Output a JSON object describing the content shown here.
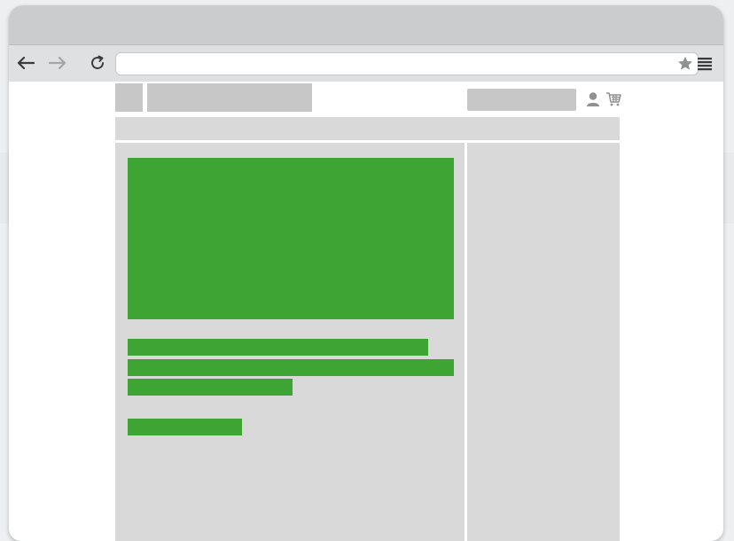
{
  "browser": {
    "address_url": "",
    "icons": {
      "back": "arrow-left-icon",
      "forward": "arrow-right-icon",
      "reload": "reload-icon",
      "bookmark": "star-icon",
      "menu": "hamburger-menu-icon",
      "account": "user-icon",
      "cart": "cart-icon"
    }
  },
  "colors": {
    "title_bar": "#cbcccd",
    "toolbar": "#dfe0e1",
    "placeholder_gray": "#c6c7c6",
    "panel_gray": "#d9d9d9",
    "accent_green": "#3ea535",
    "icon_dark": "#444444",
    "icon_light": "#a5a6a7"
  }
}
